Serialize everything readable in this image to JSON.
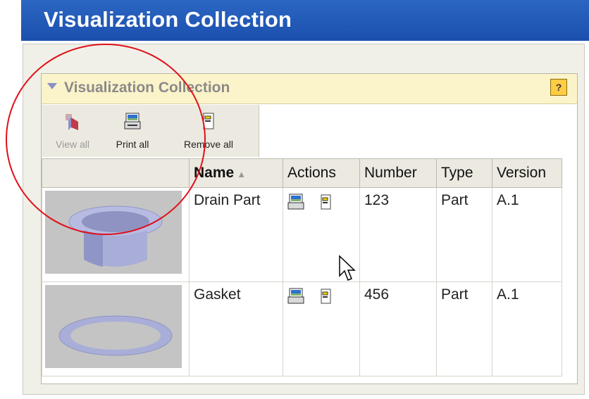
{
  "page": {
    "title": "Visualization Collection"
  },
  "panel": {
    "title": "Visualization Collection",
    "help_label": "?"
  },
  "toolbar": {
    "view_all": "View all",
    "print_all": "Print all",
    "remove_all": "Remove all"
  },
  "table": {
    "columns": [
      "Name",
      "Actions",
      "Number",
      "Type",
      "Version"
    ],
    "rows": [
      {
        "name": "Drain Part",
        "number": "123",
        "type": "Part",
        "version": "A.1"
      },
      {
        "name": "Gasket",
        "number": "456",
        "type": "Part",
        "version": "A.1"
      }
    ]
  },
  "colors": {
    "title_bar": "#1b4fae",
    "panel_header": "#fbf3c9",
    "highlight": "#e0101a",
    "thumbnail_bg": "#c4c4c4",
    "part_color": "#a9aed8"
  },
  "icons": {
    "view": "view-3d-icon",
    "print": "print-icon",
    "remove": "remove-icon",
    "help": "help-icon"
  }
}
